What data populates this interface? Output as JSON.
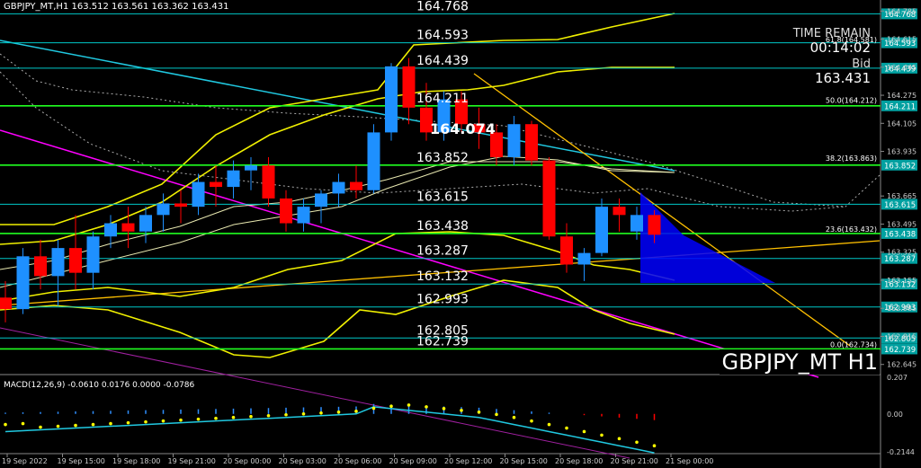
{
  "window": {
    "header": "GBPJPY_MT,H1  163.512 163.561 163.362 163.431",
    "watermark": "GBPJPY_MT H1"
  },
  "info_panel": {
    "time_label": "TIME REMAIN",
    "time_value": "00:14:02",
    "bid_label": "Bid",
    "bid_value": "163.431"
  },
  "colors": {
    "up": "#1e90ff",
    "down": "#ff0000",
    "level": "#00c8c8",
    "fib_line": "#20ff20",
    "bollinger": "#f0f000",
    "trend_cyan": "#20c8e0",
    "trend_magenta": "#ff00ff",
    "trend_yellow": "#ffc000",
    "label_bg": "#00a0a0",
    "macd_hist": "#2f8fff",
    "macd_signal": "#ffff00"
  },
  "levels": [
    {
      "price": 164.768,
      "label": "164.768",
      "axis_label": "164.768"
    },
    {
      "price": 164.593,
      "label": "164.593",
      "axis_label": "164.593"
    },
    {
      "price": 164.439,
      "label": "164.439",
      "axis_label": "164.439"
    },
    {
      "price": 164.211,
      "label": "164.211",
      "axis_label": "164.211"
    },
    {
      "price": 163.852,
      "label": "163.852",
      "axis_label": "163.852"
    },
    {
      "price": 163.615,
      "label": "163.615",
      "axis_label": "163.615"
    },
    {
      "price": 163.438,
      "label": "163.438",
      "axis_label": "163.438"
    },
    {
      "price": 163.287,
      "label": "163.287",
      "axis_label": "163.287"
    },
    {
      "price": 163.132,
      "label": "163.132",
      "axis_label": "163.132"
    },
    {
      "price": 162.993,
      "label": "162.993",
      "axis_label": "162.993"
    },
    {
      "price": 162.805,
      "label": "162.805",
      "axis_label": "162.805"
    },
    {
      "price": 162.739,
      "label": "162.739",
      "axis_label": "162.739"
    }
  ],
  "pivot_label": {
    "price": 164.074,
    "label": "164.074"
  },
  "fib_labels": [
    {
      "price": 164.212,
      "label": "50.0(164.212)"
    },
    {
      "price": 163.863,
      "label": "38.2(163.863)"
    },
    {
      "price": 163.432,
      "label": "23.6(163.432)"
    },
    {
      "price": 162.734,
      "label": "0.0(162.734)"
    },
    {
      "price": 164.581,
      "label": "61.8(164.581)"
    }
  ],
  "price_ticks": [
    "164.785",
    "164.615",
    "164.445",
    "164.275",
    "164.105",
    "163.935",
    "163.665",
    "163.495",
    "163.325",
    "163.155",
    "162.985",
    "162.815",
    "162.645"
  ],
  "price_ticks_values": [
    164.785,
    164.615,
    164.445,
    164.275,
    164.105,
    163.935,
    163.665,
    163.495,
    163.325,
    163.155,
    162.985,
    162.815,
    162.645
  ],
  "time_labels": [
    "19 Sep 2022",
    "19 Sep 15:00",
    "19 Sep 18:00",
    "19 Sep 21:00",
    "20 Sep 00:00",
    "20 Sep 03:00",
    "20 Sep 06:00",
    "20 Sep 09:00",
    "20 Sep 12:00",
    "20 Sep 15:00",
    "20 Sep 18:00",
    "20 Sep 21:00",
    "21 Sep 00:00"
  ],
  "macd": {
    "label": "MACD(12,26,9) -0.0610 0.0176 0.0000 -0.0786",
    "ticks": [
      "0.207",
      "0.00",
      "-0.2144"
    ],
    "ticks_values": [
      0.207,
      0.0,
      -0.2144
    ]
  },
  "chart_data": {
    "type": "candlestick",
    "symbol": "GBPJPY_MT",
    "timeframe": "H1",
    "ylim": [
      162.6,
      164.83
    ],
    "candles": [
      [
        163.05,
        163.15,
        162.9,
        162.98
      ],
      [
        162.98,
        163.35,
        162.95,
        163.3
      ],
      [
        163.3,
        163.4,
        163.1,
        163.18
      ],
      [
        163.18,
        163.4,
        163.0,
        163.35
      ],
      [
        163.35,
        163.55,
        163.1,
        163.2
      ],
      [
        163.2,
        163.45,
        163.1,
        163.42
      ],
      [
        163.42,
        163.55,
        163.35,
        163.5
      ],
      [
        163.5,
        163.6,
        163.35,
        163.45
      ],
      [
        163.45,
        163.6,
        163.38,
        163.55
      ],
      [
        163.55,
        163.68,
        163.45,
        163.62
      ],
      [
        163.62,
        163.7,
        163.5,
        163.6
      ],
      [
        163.6,
        163.8,
        163.55,
        163.75
      ],
      [
        163.75,
        163.85,
        163.6,
        163.72
      ],
      [
        163.72,
        163.88,
        163.65,
        163.82
      ],
      [
        163.82,
        163.9,
        163.7,
        163.85
      ],
      [
        163.85,
        163.9,
        163.6,
        163.65
      ],
      [
        163.65,
        163.7,
        163.45,
        163.5
      ],
      [
        163.5,
        163.65,
        163.45,
        163.6
      ],
      [
        163.6,
        163.7,
        163.5,
        163.68
      ],
      [
        163.68,
        163.8,
        163.6,
        163.75
      ],
      [
        163.75,
        163.85,
        163.65,
        163.7
      ],
      [
        163.7,
        164.1,
        163.68,
        164.05
      ],
      [
        164.05,
        164.47,
        164.0,
        164.45
      ],
      [
        164.45,
        164.5,
        164.1,
        164.2
      ],
      [
        164.2,
        164.35,
        164.0,
        164.05
      ],
      [
        164.05,
        164.3,
        164.0,
        164.25
      ],
      [
        164.25,
        164.3,
        164.05,
        164.1
      ],
      [
        164.1,
        164.2,
        163.95,
        164.05
      ],
      [
        164.05,
        164.1,
        163.85,
        163.9
      ],
      [
        163.9,
        164.15,
        163.85,
        164.1
      ],
      [
        164.1,
        164.12,
        163.85,
        163.88
      ],
      [
        163.88,
        163.9,
        163.4,
        163.42
      ],
      [
        163.42,
        163.5,
        163.2,
        163.25
      ],
      [
        163.25,
        163.35,
        163.15,
        163.32
      ],
      [
        163.32,
        163.65,
        163.3,
        163.6
      ],
      [
        163.6,
        163.65,
        163.45,
        163.55
      ],
      [
        163.45,
        163.6,
        163.4,
        163.55
      ],
      [
        163.55,
        163.58,
        163.38,
        163.43
      ]
    ],
    "bullish_candles_note": ""
  }
}
